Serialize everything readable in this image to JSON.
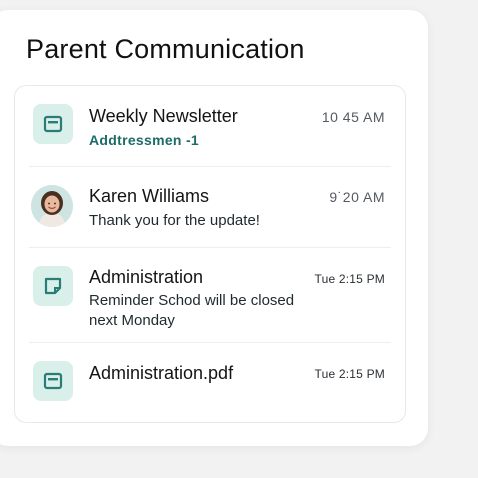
{
  "header": {
    "title": "Parent Communication"
  },
  "messages": [
    {
      "sender": "Weekly Newsletter",
      "preview": "Addtressmen  -1",
      "time": "10 45 AM",
      "icon": "document-icon"
    },
    {
      "sender": "Karen Williams",
      "preview": "Thank you for the update!",
      "time": "9˙20 AM",
      "icon": "avatar"
    },
    {
      "sender": "Administration",
      "preview": "Reminder Schod will be closed next Monday",
      "time": "Tue 2:15 PM",
      "icon": "note-icon"
    },
    {
      "sender": "Administration.pdf",
      "preview": "",
      "time": "Tue 2:15 PM",
      "icon": "pdf-icon"
    }
  ],
  "colors": {
    "accent": "#1d6b66",
    "icon_bg": "#d9efea",
    "icon_fg": "#2a7d77"
  }
}
